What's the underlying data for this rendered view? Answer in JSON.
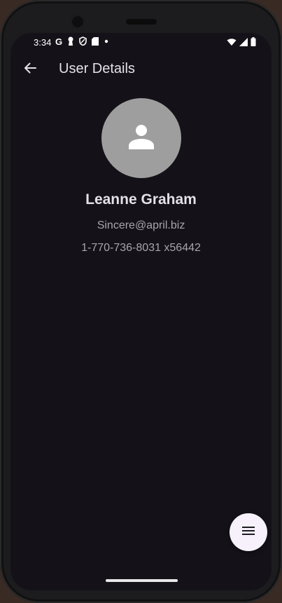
{
  "status_bar": {
    "time": "3:34",
    "google_icon": "google-g-icon",
    "notification_icons": [
      "keyhole-icon",
      "shield-icon",
      "sd-card-icon",
      "dot-icon"
    ],
    "system_icons": [
      "wifi-icon",
      "signal-icon",
      "battery-icon"
    ]
  },
  "app_bar": {
    "title": "User Details",
    "back_icon": "arrow-back-icon"
  },
  "user": {
    "avatar_icon": "person-icon",
    "name": "Leanne Graham",
    "email": "Sincere@april.biz",
    "phone": "1-770-736-8031 x56442"
  },
  "fab": {
    "icon": "menu-icon"
  },
  "colors": {
    "background": "#141218",
    "on_surface": "#e6e0e9",
    "secondary_text": "#a8a4ad",
    "avatar_bg": "#9e9e9e",
    "fab_bg": "#f6f1fb"
  }
}
